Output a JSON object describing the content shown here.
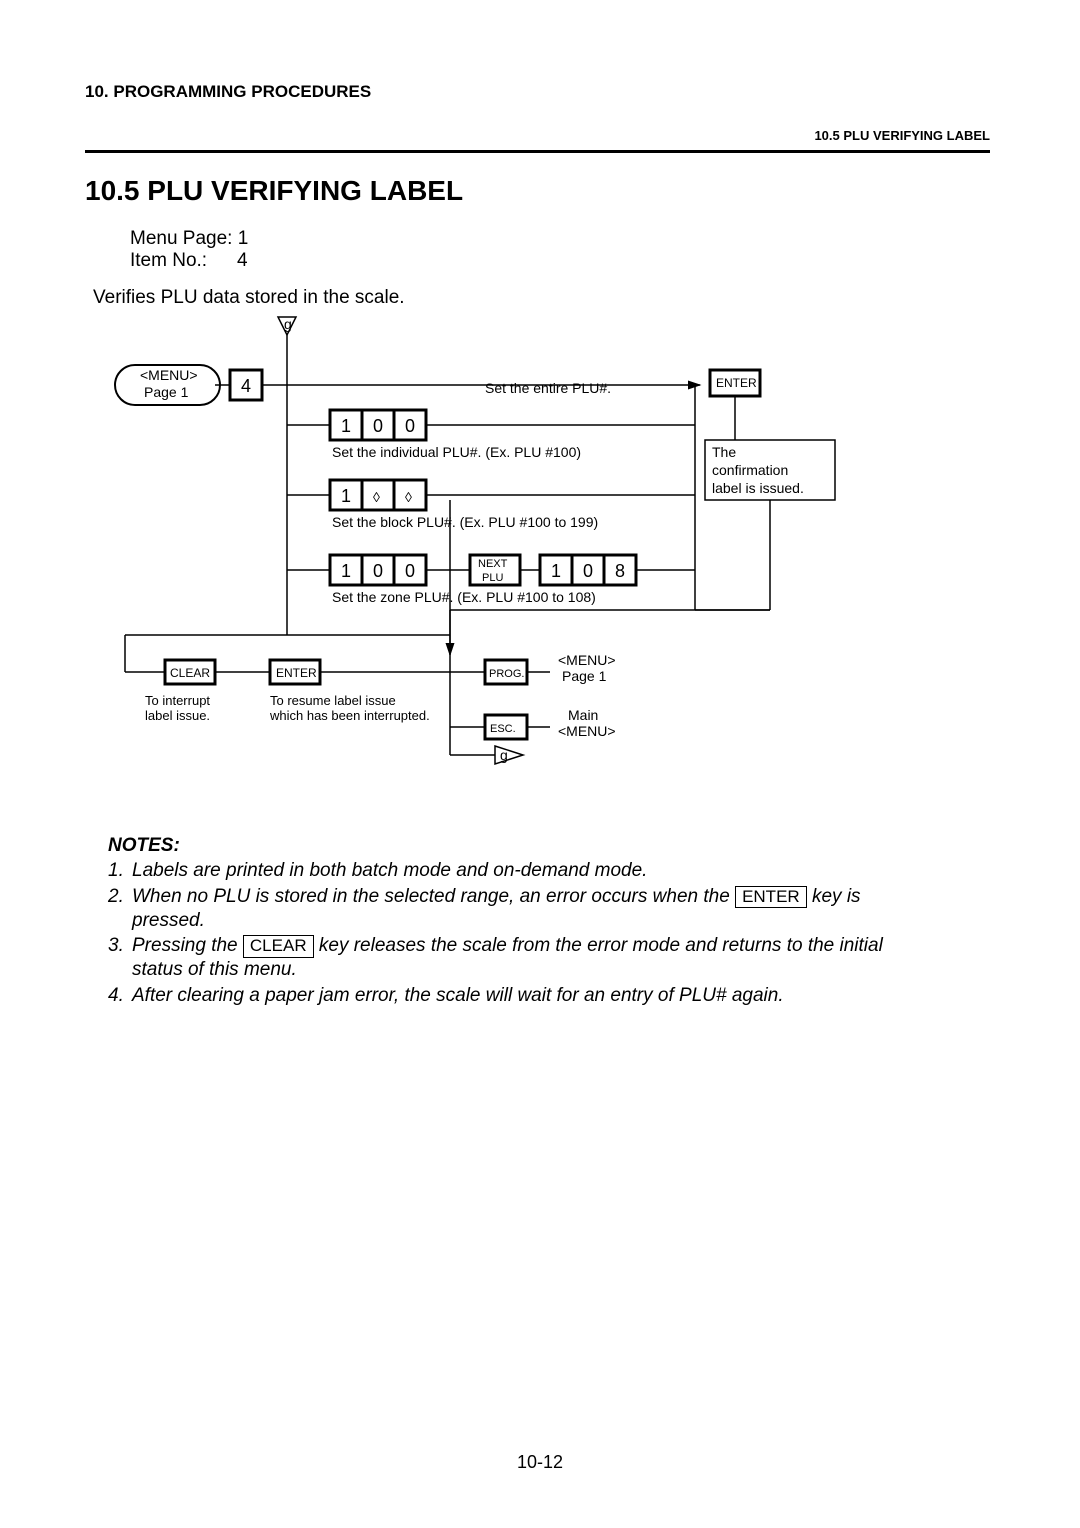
{
  "header": {
    "chapter": "10.   PROGRAMMING PROCEDURES",
    "section_right": "10.5 PLU VERIFYING LABEL"
  },
  "title": "10.5  PLU VERIFYING LABEL",
  "menu_page": "Menu Page: 1",
  "item_no_label": "Item No.:",
  "item_no_value": "4",
  "verifies": "Verifies PLU data stored in the scale.",
  "diagram": {
    "g_top": "g",
    "menu_p1": "<MENU>",
    "menu_p1b": "Page 1",
    "key4": "4",
    "set_entire": "Set the entire PLU#.",
    "enter": "ENTER",
    "row_ind": {
      "d1": "1",
      "d2": "0",
      "d3": "0",
      "caption": "Set the individual PLU#.   (Ex. PLU #100)"
    },
    "confirm1": "The",
    "confirm2": "confirmation",
    "confirm3": "label is issued.",
    "row_block": {
      "d1": "1",
      "d2": "◊",
      "d3": "◊",
      "caption": "Set the block PLU#.    (Ex. PLU #100 to 199)"
    },
    "row_zone_a": {
      "d1": "1",
      "d2": "0",
      "d3": "0"
    },
    "nextplu1": "NEXT",
    "nextplu2": "PLU",
    "row_zone_b": {
      "d1": "1",
      "d2": "0",
      "d3": "8"
    },
    "zone_caption": "Set the zone PLU#.   (Ex. PLU #100 to 108)",
    "clear": "CLEAR",
    "enter2": "ENTER",
    "interrupt1": "To interrupt",
    "interrupt2": "label issue.",
    "resume1": "To resume label issue",
    "resume2": "which has been interrupted.",
    "prog": "PROG.",
    "menu_r1": "<MENU>",
    "menu_r1b": "Page 1",
    "esc": "ESC.",
    "menu_r2": "Main",
    "menu_r2b": "<MENU>",
    "g_bottom": "g"
  },
  "notes": {
    "title": "NOTES:",
    "n1": "Labels are printed in both batch mode and on-demand mode.",
    "n2a": "When no PLU is stored in the selected range, an error occurs when the",
    "n2key": "ENTER",
    "n2b": "key is",
    "n2c": "pressed.",
    "n3a": "Pressing the",
    "n3key": "CLEAR",
    "n3b": "key releases the scale from the error mode and returns to the initial",
    "n3c": "status of this menu.",
    "n4": "After clearing a paper jam error, the scale will wait for an entry of PLU# again."
  },
  "footer": "10-12"
}
